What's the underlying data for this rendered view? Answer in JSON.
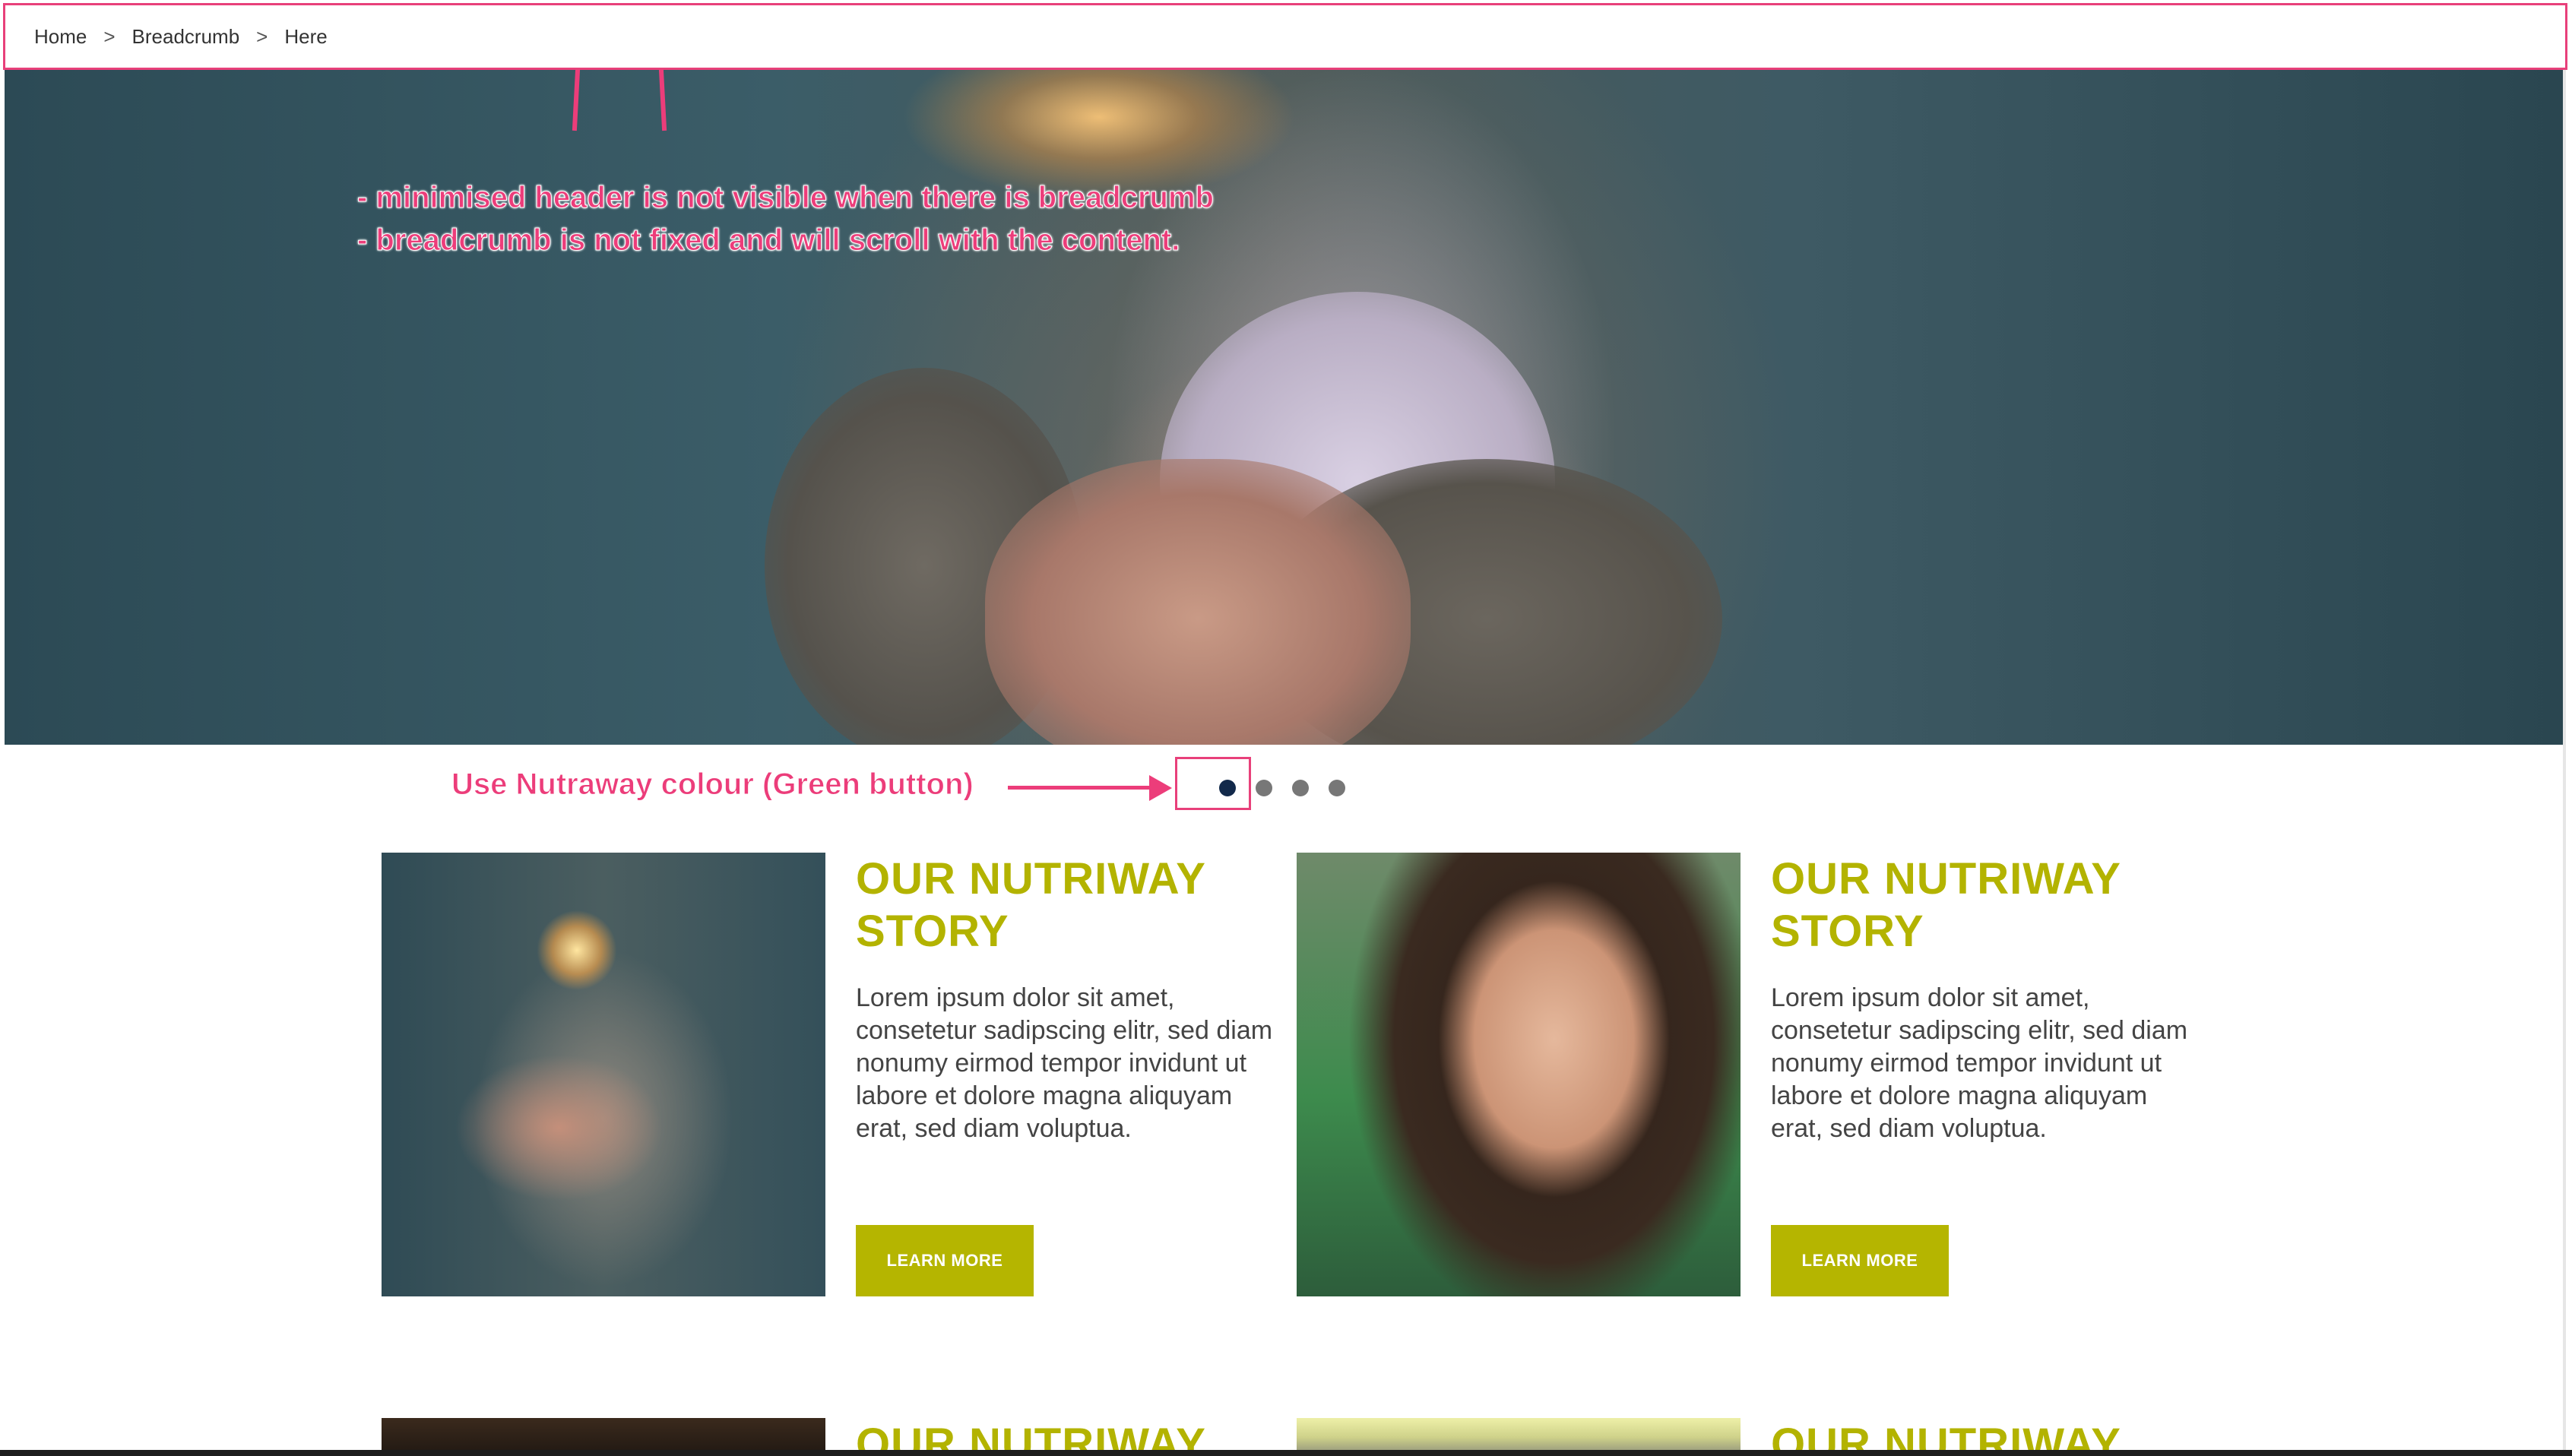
{
  "breadcrumb": {
    "items": [
      "Home",
      "Breadcrumb",
      "Here"
    ],
    "separator": ">"
  },
  "annotations": {
    "header_note_line1": "- minimised header is not visible when there is breadcrumb",
    "header_note_line2": "- breadcrumb is not fixed and will scroll with the content.",
    "dots_note": "Use Nutraway colour (Green button)"
  },
  "carousel": {
    "slide_count": 4,
    "active_index": 0
  },
  "cards": [
    {
      "title": "OUR NUTRIWAY STORY",
      "body": "Lorem ipsum dolor sit amet, consetetur sadipscing elitr, sed diam nonumy eirmod tempor invidunt ut labore et dolore magna aliquyam erat, sed diam voluptua.",
      "button": "LEARN MORE",
      "image": "sparkler-photo"
    },
    {
      "title": "OUR NUTRIWAY STORY",
      "body": "Lorem ipsum dolor sit amet, consetetur sadipscing elitr, sed diam nonumy eirmod tempor invidunt ut labore et dolore magna aliquyam erat, sed diam voluptua.",
      "button": "LEARN MORE",
      "image": "portrait-photo"
    },
    {
      "title": "OUR NUTRIWAY",
      "image": "dark-photo"
    },
    {
      "title": "OUR NUTRIWAY",
      "image": "light-photo"
    }
  ],
  "colors": {
    "accent": "#b3b300",
    "annotation": "#ec3d7a",
    "dot_active": "#12294a",
    "dot_inactive": "#777777"
  }
}
